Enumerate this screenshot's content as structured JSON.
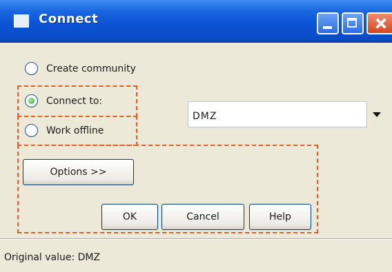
{
  "window": {
    "title": "Connect",
    "icon": "window-app-icon",
    "controls": {
      "minimize": "minimize-icon",
      "maximize": "maximize-icon",
      "close": "close-icon"
    }
  },
  "options": {
    "create_community": {
      "label": "Create community",
      "checked": false
    },
    "connect_to": {
      "label": "Connect to:",
      "checked": true
    },
    "work_offline": {
      "label": "Work offline",
      "checked": false
    }
  },
  "combo": {
    "value": "DMZ",
    "arrow_icon": "dropdown-arrow-icon"
  },
  "buttons": {
    "options": "Options >>",
    "ok": "OK",
    "cancel": "Cancel",
    "help": "Help"
  },
  "status": {
    "text": "Original value: DMZ"
  },
  "colors": {
    "titlebar": "#0b53d6",
    "dialog_background": "#ece9d8",
    "highlight_dash": "#e85b20"
  }
}
